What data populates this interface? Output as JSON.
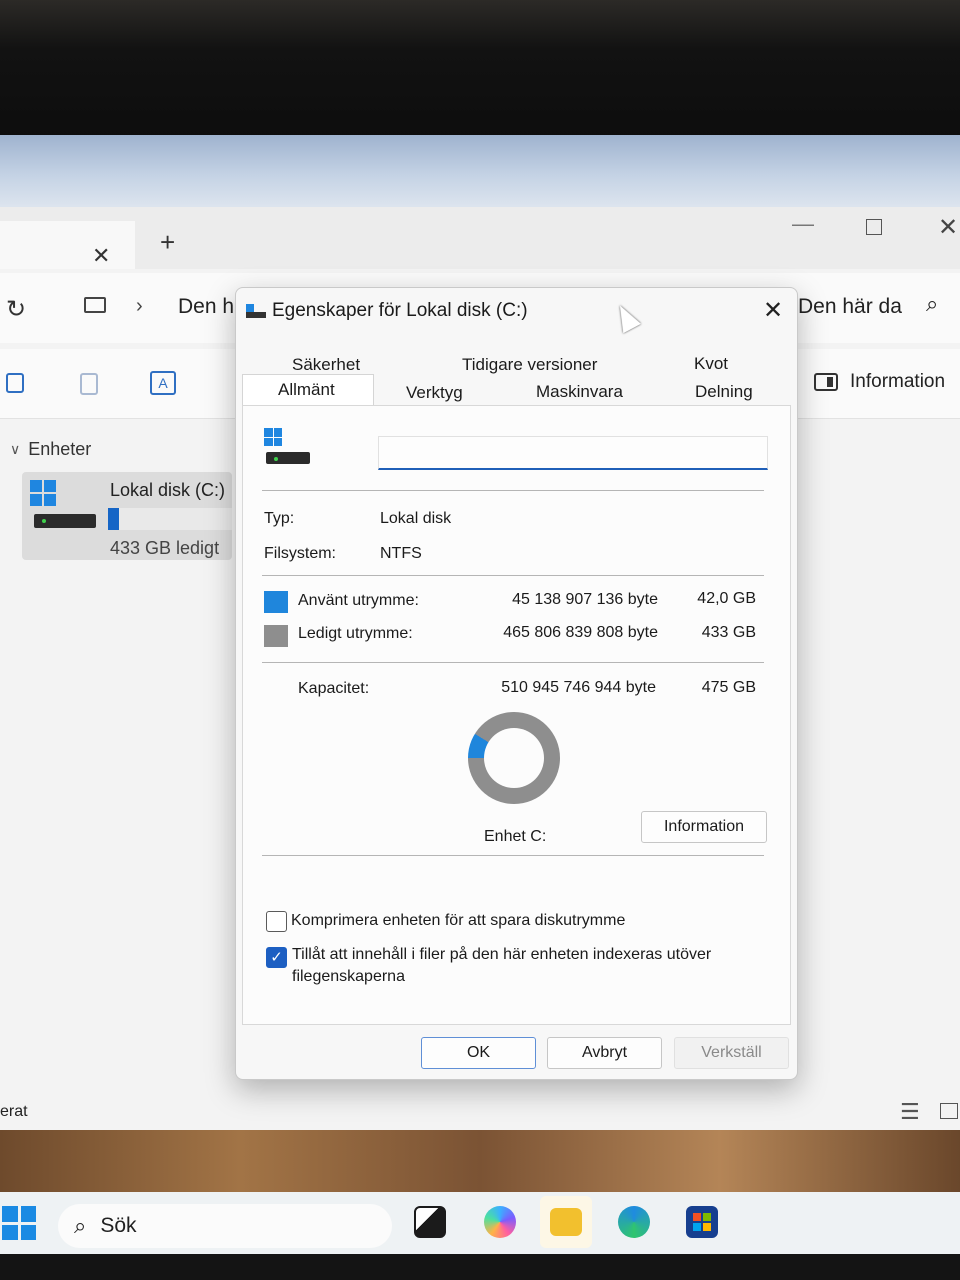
{
  "explorer": {
    "breadcrumb": "Den h",
    "search_text": "Den här da",
    "info_label": "Information",
    "nav_section": "Enheter",
    "drive_name": "Lokal disk (C:)",
    "drive_free": "433 GB ledigt",
    "drive_used_fraction": 0.088,
    "status_text": "erat"
  },
  "taskbar": {
    "search_label": "Sök"
  },
  "dialog": {
    "title": "Egenskaper för Lokal disk (C:)",
    "tabs_top": [
      "Säkerhet",
      "Tidigare versioner",
      "Kvot"
    ],
    "tabs_bottom": [
      "Allmänt",
      "Verktyg",
      "Maskinvara",
      "Delning"
    ],
    "selected_tab": "Allmänt",
    "name_value": "",
    "type_label": "Typ:",
    "type_value": "Lokal disk",
    "fs_label": "Filsystem:",
    "fs_value": "NTFS",
    "used_label": "Använt utrymme:",
    "used_bytes": "45 138 907 136 byte",
    "used_gb": "42,0 GB",
    "free_label": "Ledigt utrymme:",
    "free_bytes": "465 806 839 808 byte",
    "free_gb": "433 GB",
    "capacity_label": "Kapacitet:",
    "capacity_bytes": "510 945 746 944 byte",
    "capacity_gb": "475 GB",
    "drive_label": "Enhet C:",
    "info_button": "Information",
    "compress_label": "Komprimera enheten för att spara diskutrymme",
    "compress_checked": false,
    "index_label_line1": "Tillåt att innehåll i filer på den här enheten indexeras utöver",
    "index_label_line2": "filegenskaperna",
    "index_checked": true,
    "ok": "OK",
    "cancel": "Avbryt",
    "apply": "Verkställ",
    "used_fraction": 0.088
  },
  "colors": {
    "used": "#1f86dc",
    "free": "#8e8e8e",
    "accent": "#1d5fc2"
  }
}
